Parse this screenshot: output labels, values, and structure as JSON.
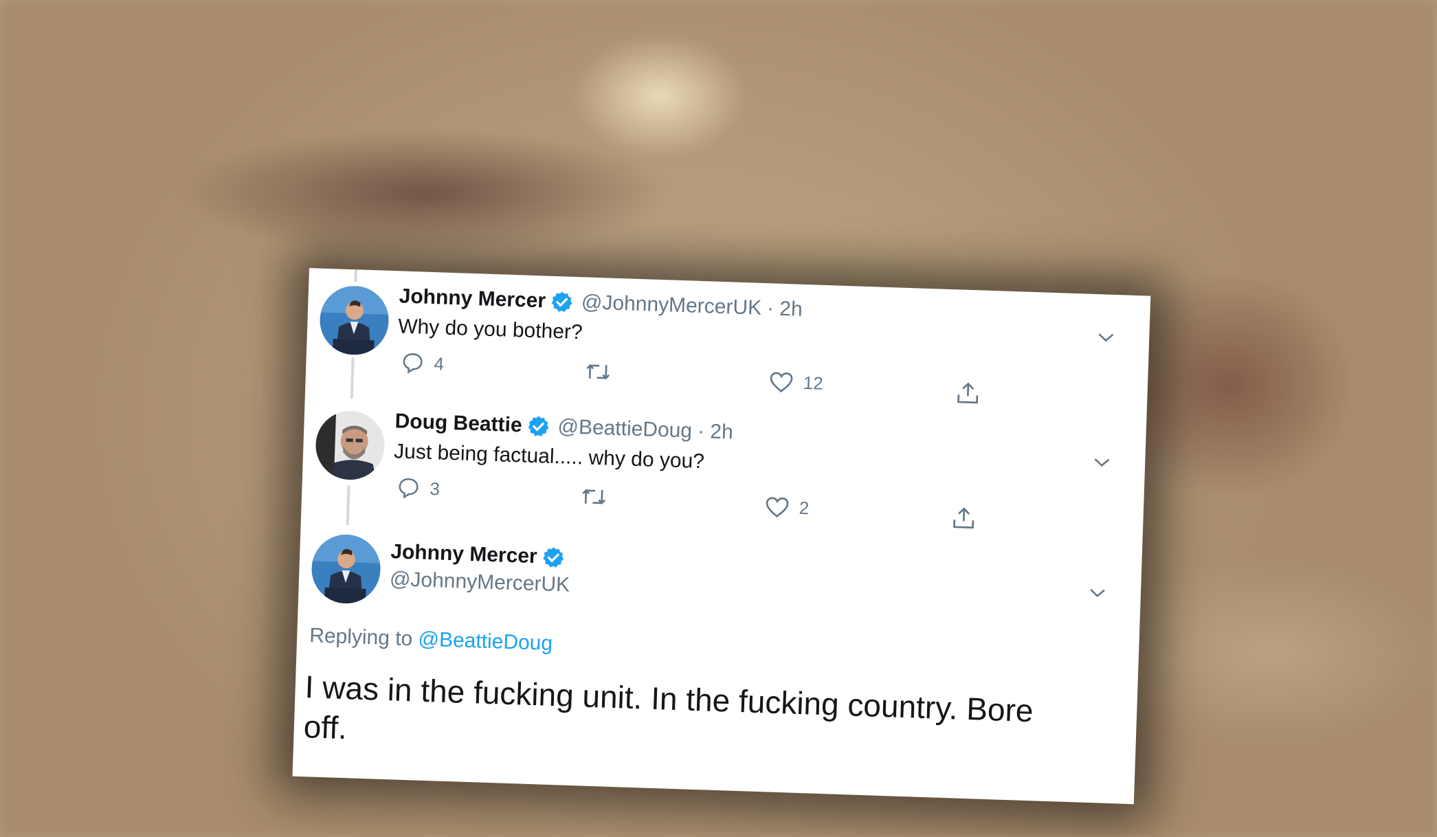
{
  "colors": {
    "verified_blue": "#1da1f2",
    "handle_gray": "#657786",
    "text": "#14171a",
    "thread_line": "#cfd9de"
  },
  "tweets": [
    {
      "name": "Johnny Mercer",
      "handle": "@JohnnyMercerUK",
      "time": "· 2h",
      "text": "Why do you bother?",
      "replies": "4",
      "retweets": "",
      "likes": "12",
      "avatar_icon": "profile-photo-johnny-mercer"
    },
    {
      "name": "Doug Beattie",
      "handle": "@BeattieDoug",
      "time": "· 2h",
      "text": "Just being factual..... why do you?",
      "replies": "3",
      "retweets": "",
      "likes": "2",
      "avatar_icon": "profile-photo-doug-beattie"
    }
  ],
  "main_tweet": {
    "name": "Johnny Mercer",
    "handle": "@JohnnyMercerUK",
    "replying_label": "Replying to",
    "replying_to": "@BeattieDoug",
    "text_line1": "I was in the fucking unit. In the fucking country. Bore",
    "text_line2": "off.",
    "avatar_icon": "profile-photo-johnny-mercer"
  },
  "icons": {
    "reply": "speech-bubble-icon",
    "retweet": "retweet-icon",
    "like": "heart-icon",
    "share": "share-icon",
    "more": "chevron-down-icon",
    "verified": "verified-badge-icon"
  }
}
